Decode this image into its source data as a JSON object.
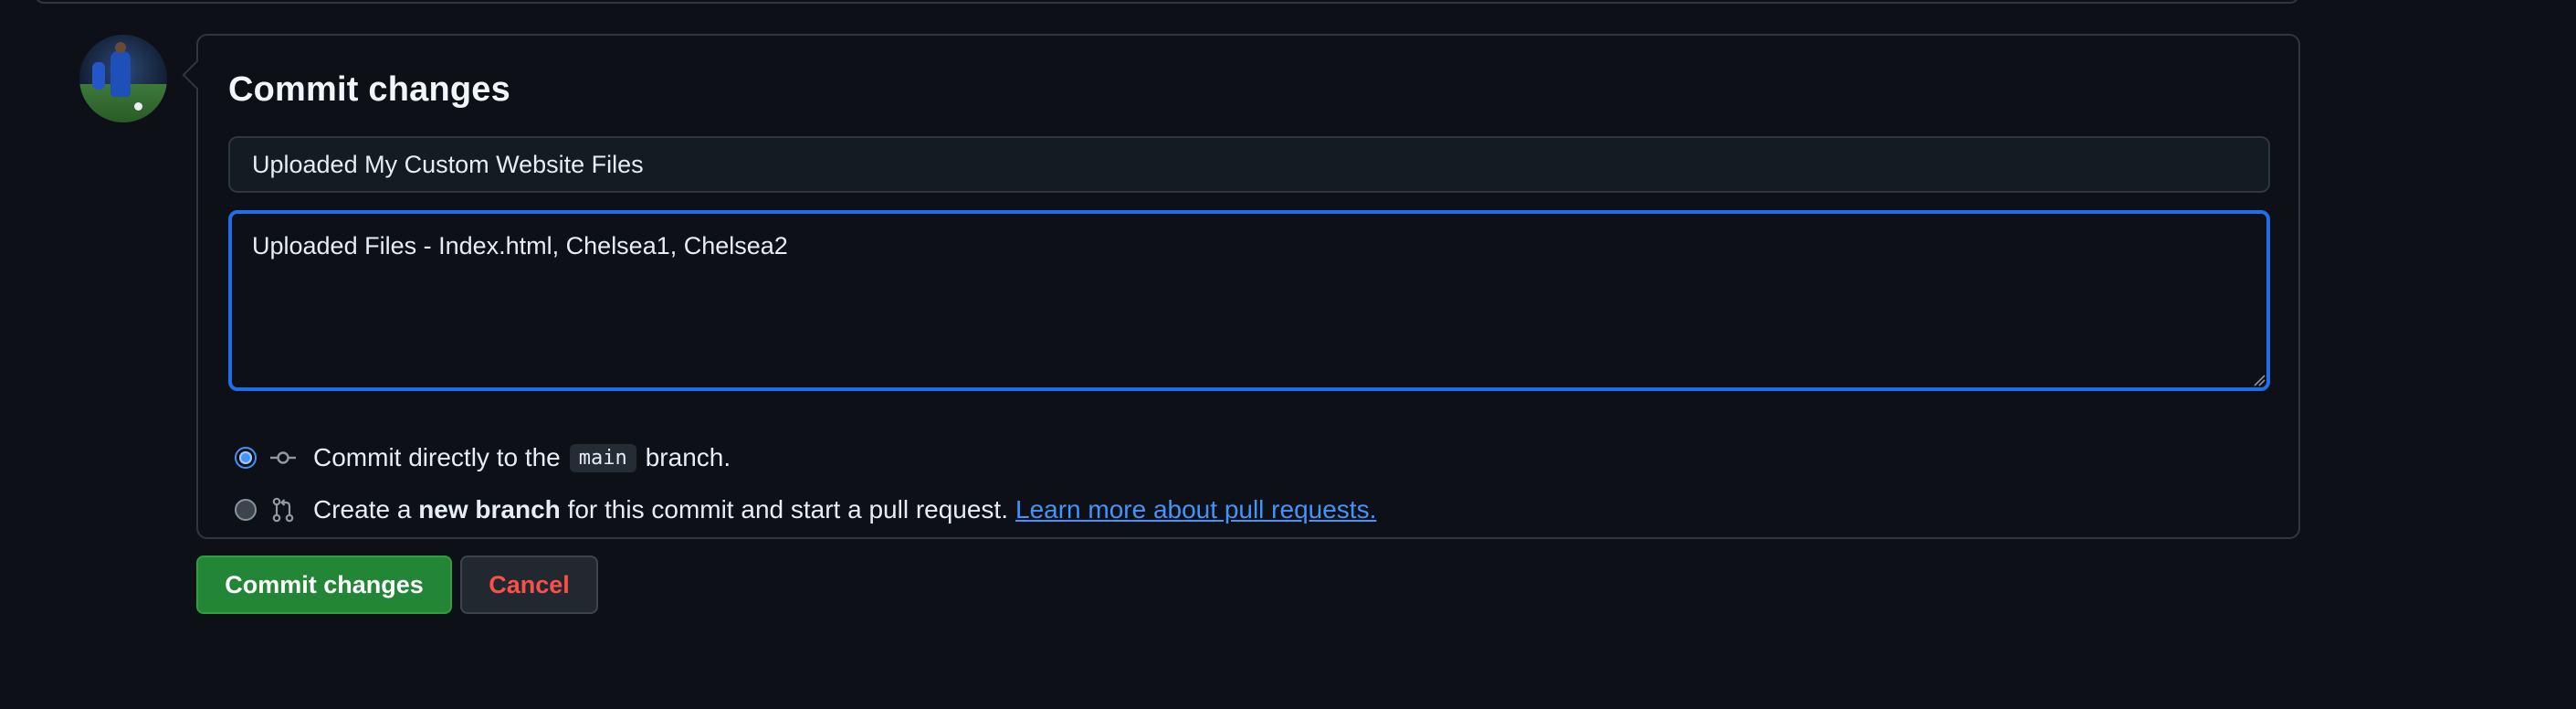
{
  "commit_form": {
    "title": "Commit changes",
    "summary_value": "Uploaded My Custom Website Files",
    "description_value": "Uploaded Files - Index.html, Chelsea1, Chelsea2",
    "option_direct": {
      "text_before": "Commit directly to the",
      "branch_name": "main",
      "text_after": "branch.",
      "selected": true,
      "icon": "git-commit-icon"
    },
    "option_new_branch": {
      "text_before": "Create a",
      "bold_text": "new branch",
      "text_after": "for this commit and start a pull request.",
      "link_text": "Learn more about pull requests.",
      "selected": false,
      "icon": "git-pull-request-icon"
    }
  },
  "actions": {
    "commit_label": "Commit changes",
    "cancel_label": "Cancel"
  },
  "colors": {
    "background": "#0d1117",
    "accent_blue": "#1f6feb",
    "link_blue": "#4493f8",
    "commit_green": "#238636",
    "cancel_red": "#f85149",
    "border": "#30363d"
  }
}
